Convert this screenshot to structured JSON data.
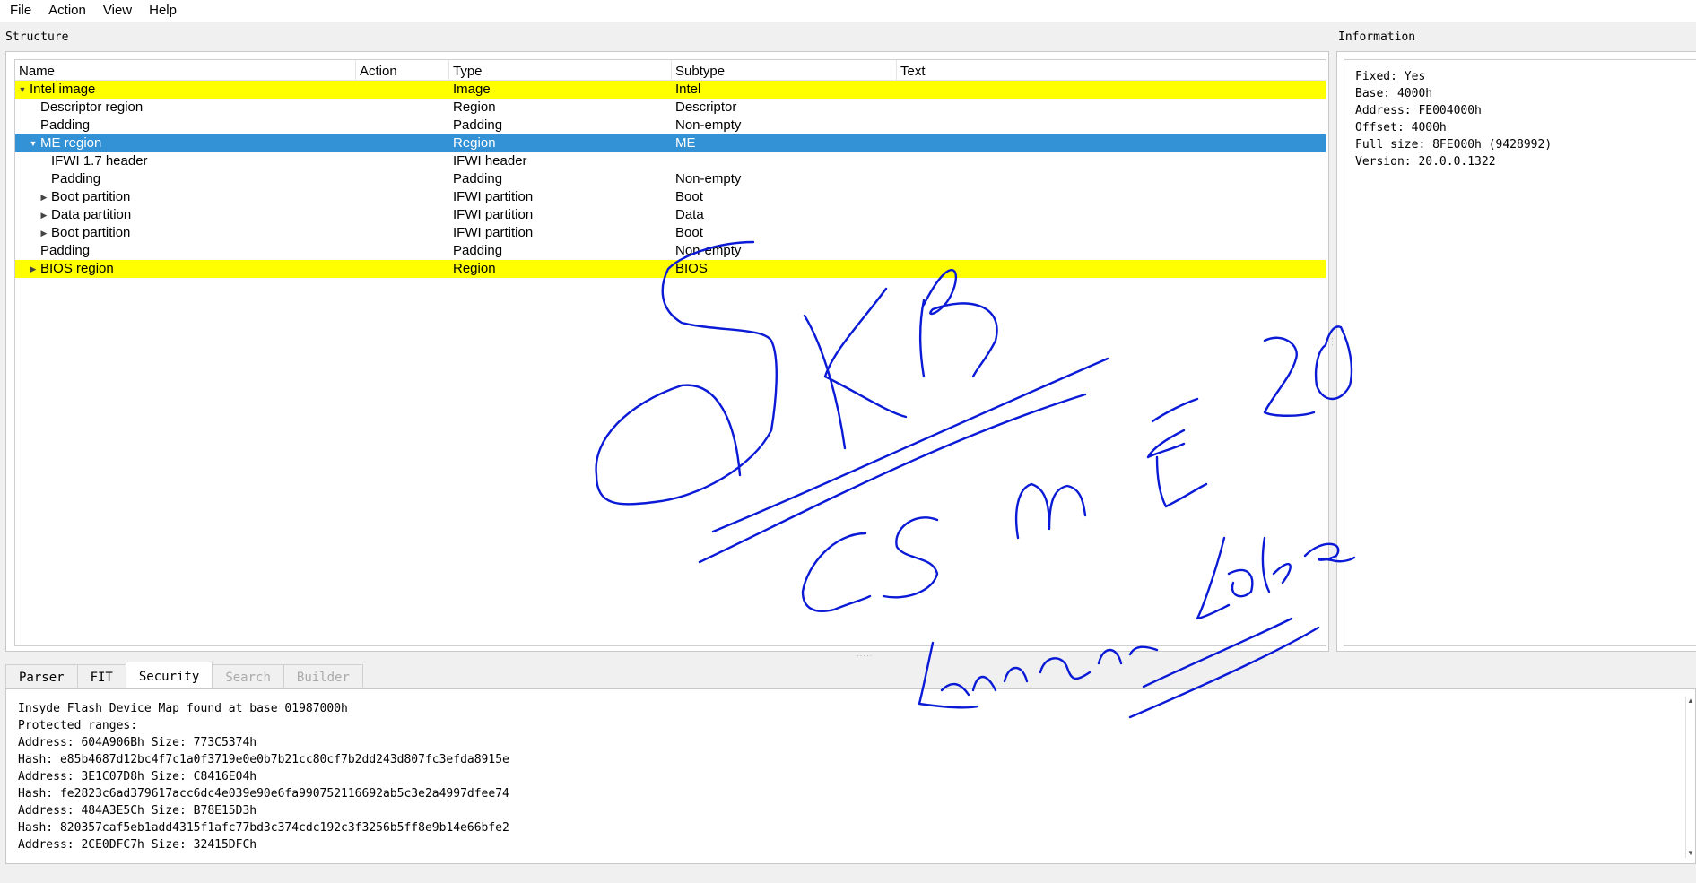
{
  "menu": [
    {
      "label": "File"
    },
    {
      "label": "Action"
    },
    {
      "label": "View"
    },
    {
      "label": "Help"
    }
  ],
  "structure_label": "Structure",
  "information_label": "Information",
  "columns": [
    "Name",
    "Action",
    "Type",
    "Subtype",
    "Text"
  ],
  "rows": [
    {
      "name": "Intel image",
      "action": "",
      "type": "Image",
      "subtype": "Intel",
      "text": "",
      "level": 0,
      "arrow": "expanded",
      "style": "yellow"
    },
    {
      "name": "Descriptor region",
      "action": "",
      "type": "Region",
      "subtype": "Descriptor",
      "text": "",
      "level": 1,
      "arrow": "",
      "style": ""
    },
    {
      "name": "Padding",
      "action": "",
      "type": "Padding",
      "subtype": "Non-empty",
      "text": "",
      "level": 1,
      "arrow": "",
      "style": ""
    },
    {
      "name": "ME region",
      "action": "",
      "type": "Region",
      "subtype": "ME",
      "text": "",
      "level": 1,
      "arrow": "expanded",
      "style": "selected"
    },
    {
      "name": "IFWI 1.7 header",
      "action": "",
      "type": "IFWI header",
      "subtype": "",
      "text": "",
      "level": 2,
      "arrow": "",
      "style": ""
    },
    {
      "name": "Padding",
      "action": "",
      "type": "Padding",
      "subtype": "Non-empty",
      "text": "",
      "level": 2,
      "arrow": "",
      "style": ""
    },
    {
      "name": "Boot partition",
      "action": "",
      "type": "IFWI partition",
      "subtype": "Boot",
      "text": "",
      "level": 2,
      "arrow": "collapsed",
      "style": ""
    },
    {
      "name": "Data partition",
      "action": "",
      "type": "IFWI partition",
      "subtype": "Data",
      "text": "",
      "level": 2,
      "arrow": "collapsed",
      "style": ""
    },
    {
      "name": "Boot partition",
      "action": "",
      "type": "IFWI partition",
      "subtype": "Boot",
      "text": "",
      "level": 2,
      "arrow": "collapsed",
      "style": ""
    },
    {
      "name": "Padding",
      "action": "",
      "type": "Padding",
      "subtype": "Non-empty",
      "text": "",
      "level": 1,
      "arrow": "",
      "style": ""
    },
    {
      "name": "BIOS region",
      "action": "",
      "type": "Region",
      "subtype": "BIOS",
      "text": "",
      "level": 1,
      "arrow": "collapsed",
      "style": "yellow"
    }
  ],
  "information": [
    "Fixed: Yes",
    "Base: 4000h",
    "Address: FE004000h",
    "Offset: 4000h",
    "Full size: 8FE000h (9428992)",
    "Version: 20.0.0.1322"
  ],
  "tabs": [
    {
      "label": "Parser",
      "state": "normal"
    },
    {
      "label": "FIT",
      "state": "normal"
    },
    {
      "label": "Security",
      "state": "active"
    },
    {
      "label": "Search",
      "state": "disabled"
    },
    {
      "label": "Builder",
      "state": "disabled"
    }
  ],
  "log": [
    "Insyde Flash Device Map found at base 01987000h",
    "Protected ranges:",
    "Address: 604A906Bh Size: 773C5374h",
    "Hash: e85b4687d12bc4f7c1a0f3719e0e0b7b21cc80cf7b2dd243d807fc3efda8915e",
    "Address: 3E1C07D8h Size: C8416E04h",
    "Hash: fe2823c6ad379617acc6dc4e039e90e6fa990752116692ab5c3e2a4997dfee74",
    "Address: 484A3E5Ch Size: B78E15D3h",
    "Hash: 820357caf5eb1add4315f1afc77bd3c374cdc192c3f3256b5ff8e9b14e66bfe2",
    "Address: 2CE0DFC7h Size: 32415DFCh"
  ],
  "ink_color": "#0a1ad6",
  "accent_selected": "#3391d5",
  "highlight_yellow": "#ffff00"
}
